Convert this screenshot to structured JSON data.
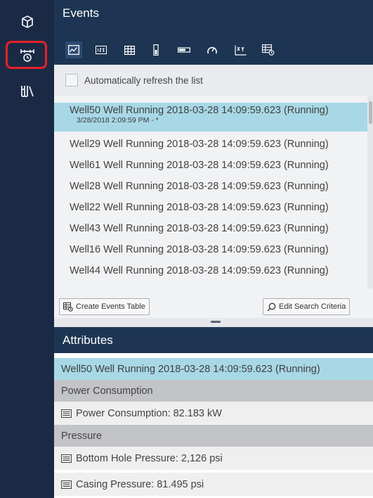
{
  "rail": {
    "items": [
      {
        "name": "cube-icon"
      },
      {
        "name": "events-icon",
        "highlighted": true
      },
      {
        "name": "library-icon"
      }
    ],
    "highlight_color": "#e8202a"
  },
  "events": {
    "title": "Events",
    "toolbar": [
      "trend-icon",
      "numeric-value-icon",
      "table-icon",
      "vertical-gauge-icon",
      "horizontal-gauge-icon",
      "radial-gauge-icon",
      "xy-plot-icon",
      "asset-comparison-table-icon"
    ],
    "auto_refresh_label": "Automatically refresh the list",
    "list": [
      {
        "title": "Well50 Well Running 2018-03-28 14:09:59.623 (Running)",
        "subtitle": "3/28/2018 2:09:59 PM - *",
        "selected": true
      },
      {
        "title": "Well29 Well Running 2018-03-28 14:09:59.623 (Running)"
      },
      {
        "title": "Well61 Well Running 2018-03-28 14:09:59.623 (Running)"
      },
      {
        "title": "Well28 Well Running 2018-03-28 14:09:59.623 (Running)"
      },
      {
        "title": "Well22 Well Running 2018-03-28 14:09:59.623 (Running)"
      },
      {
        "title": "Well43 Well Running 2018-03-28 14:09:59.623 (Running)"
      },
      {
        "title": "Well16 Well Running 2018-03-28 14:09:59.623 (Running)"
      },
      {
        "title": "Well44 Well Running 2018-03-28 14:09:59.623 (Running)"
      }
    ],
    "create_table_label": "Create Events Table",
    "edit_search_label": "Edit Search Criteria"
  },
  "attributes": {
    "title": "Attributes",
    "selected_event": "Well50 Well Running 2018-03-28 14:09:59.623 (Running)",
    "groups": [
      {
        "name": "Power Consumption",
        "items": [
          "Power Consumption: 82.183 kW"
        ]
      },
      {
        "name": "Pressure",
        "items": [
          "Bottom Hole Pressure: 2,126 psi",
          "Casing Pressure: 81.495 psi"
        ]
      }
    ]
  },
  "colors": {
    "rail_bg": "#1b2a44",
    "header_bg": "#1d3553",
    "selected_bg": "#a8d8e6",
    "group_bg": "#c3c4c7"
  }
}
